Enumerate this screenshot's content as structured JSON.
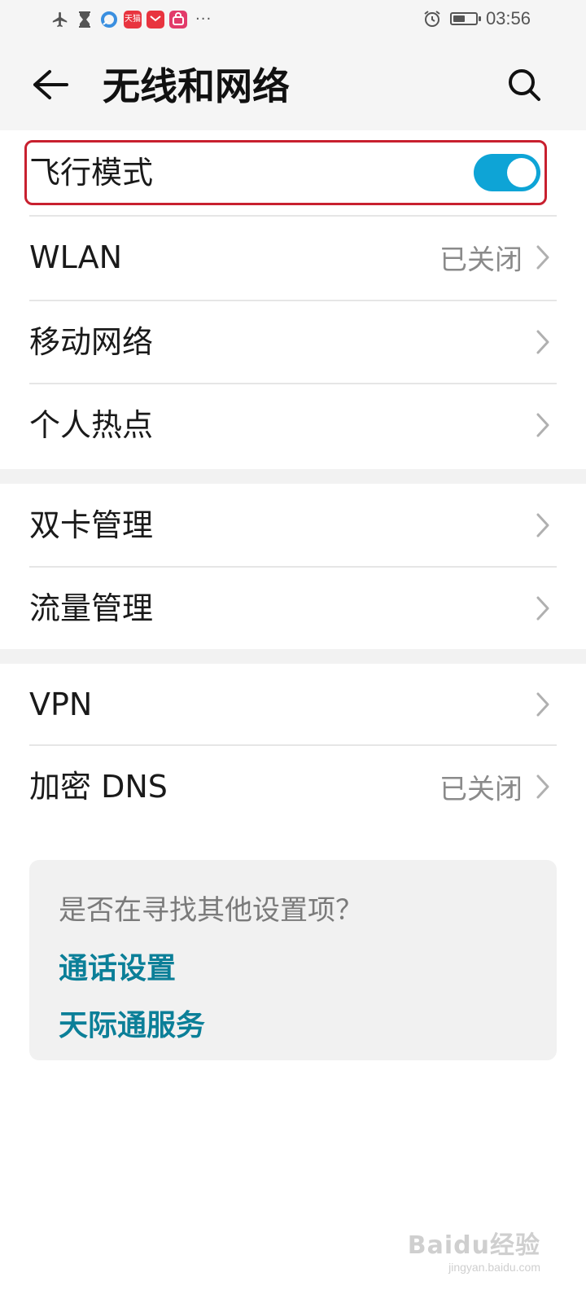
{
  "status_bar": {
    "left_icons": [
      "airplane-icon",
      "hourglass-icon",
      "browser-icon",
      "tmall-app-icon",
      "mail-app-icon",
      "shopping-app-icon"
    ],
    "app_badge_text": "天猫",
    "more_indicator": "···",
    "time": "03:56",
    "battery_level": 0.55
  },
  "header": {
    "title": "无线和网络"
  },
  "rows": [
    {
      "label": "飞行模式",
      "toggle_on": true,
      "highlighted": true
    },
    {
      "label": "WLAN",
      "status": "已关闭"
    },
    {
      "label": "移动网络"
    },
    {
      "label": "个人热点"
    },
    {
      "label": "双卡管理"
    },
    {
      "label": "流量管理"
    },
    {
      "label": "VPN"
    },
    {
      "label": "加密 DNS",
      "status": "已关闭"
    }
  ],
  "suggestion_card": {
    "question": "是否在寻找其他设置项？",
    "links": [
      "通话设置",
      "天际通服务"
    ]
  },
  "watermark": {
    "main": "Baidu经验",
    "sub": "jingyan.baidu.com"
  },
  "colors": {
    "accent": "#0ea4d6",
    "link": "#0b7f98",
    "highlight_border": "#c8202f"
  }
}
